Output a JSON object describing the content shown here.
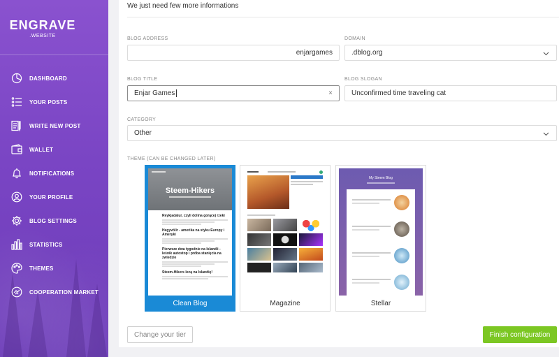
{
  "brand": {
    "name": "ENGRAVE",
    "sub": ".WEBSITE"
  },
  "sidebar": {
    "items": [
      {
        "label": "DASHBOARD",
        "icon": "dashboard-icon"
      },
      {
        "label": "YOUR POSTS",
        "icon": "list-icon"
      },
      {
        "label": "WRITE NEW POST",
        "icon": "write-icon"
      },
      {
        "label": "WALLET",
        "icon": "wallet-icon"
      },
      {
        "label": "NOTIFICATIONS",
        "icon": "bell-icon"
      },
      {
        "label": "YOUR PROFILE",
        "icon": "profile-icon"
      },
      {
        "label": "BLOG SETTINGS",
        "icon": "gear-icon"
      },
      {
        "label": "STATISTICS",
        "icon": "stats-icon"
      },
      {
        "label": "THEMES",
        "icon": "palette-icon"
      },
      {
        "label": "COOPERATION MARKET",
        "icon": "handshake-icon"
      }
    ]
  },
  "form": {
    "intro": "We just need few more informations",
    "blog_address": {
      "label": "BLOG ADDRESS",
      "value": "enjargames"
    },
    "domain": {
      "label": "DOMAIN",
      "value": ".dblog.org"
    },
    "blog_title": {
      "label": "BLOG TITLE",
      "value": "Enjar Games",
      "clear": "×"
    },
    "blog_slogan": {
      "label": "BLOG SLOGAN",
      "value": "Unconfirmed time traveling cat"
    },
    "category": {
      "label": "CATEGORY",
      "value": "Other"
    },
    "theme_label": "THEME (CAN BE CHANGED LATER)"
  },
  "themes": [
    {
      "name": "Clean Blog",
      "selected": true,
      "preview": {
        "hero": "Steem-Hikers",
        "posts": [
          "Reykjadalur, czyli dolina gorącej rzeki",
          "Hegyvölir - amerika na styku Europy i Ameryki",
          "Pierwsze dwa tygodnie na Islandii - leśnik autostop i próba stanięcia na zwiedzie",
          "Steem-Hikers lecą na Islandię!"
        ]
      }
    },
    {
      "name": "Magazine",
      "selected": false
    },
    {
      "name": "Stellar",
      "selected": false,
      "preview": {
        "hero": "My Steem Blog"
      }
    }
  ],
  "actions": {
    "change_tier": "Change your tier",
    "finish": "Finish configuration"
  },
  "colors": {
    "sidebar": "#7a45c4",
    "selected_theme": "#1a8ad6",
    "finish_button": "#7cc723"
  }
}
